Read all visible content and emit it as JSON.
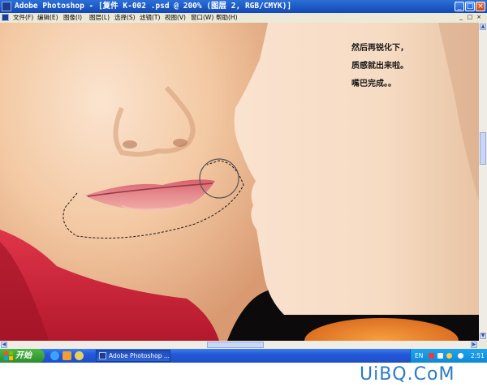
{
  "window": {
    "title": "Adobe Photoshop - [复件 K-002 .psd @ 200% (图层 2, RGB/CMYK)]",
    "min_glyph": "_",
    "max_glyph": "□",
    "close_glyph": "×"
  },
  "menu": {
    "items": [
      {
        "label": "文件",
        "key": "(F)"
      },
      {
        "label": "编辑",
        "key": "(E)"
      },
      {
        "label": "图像",
        "key": "(I)"
      },
      {
        "label": "图层",
        "key": "(L)"
      },
      {
        "label": "选择",
        "key": "(S)"
      },
      {
        "label": "滤镜",
        "key": "(T)"
      },
      {
        "label": "视图",
        "key": "(V)"
      },
      {
        "label": "窗口",
        "key": "(W)"
      },
      {
        "label": "帮助",
        "key": "(H)"
      }
    ],
    "doc_controls": [
      "_",
      "□",
      "×"
    ]
  },
  "canvas": {
    "notes": [
      "然后再锐化下，",
      "质感就出来啦。",
      "嘴巴完成。。"
    ]
  },
  "taskbar": {
    "start_label": "开始",
    "quick_launch_icons": [
      "ie-icon",
      "media-player-icon",
      "outlook-icon"
    ],
    "task_label": "Adobe Photoshop ...",
    "language": "EN",
    "clock": "2:51"
  },
  "watermark": "UiBQ.CoM",
  "colors": {
    "title_bar": "#1e56c8",
    "taskbar": "#2458d8",
    "start_button": "#3a9f36",
    "tray": "#1196e2",
    "watermark": "#2a7cc4"
  }
}
